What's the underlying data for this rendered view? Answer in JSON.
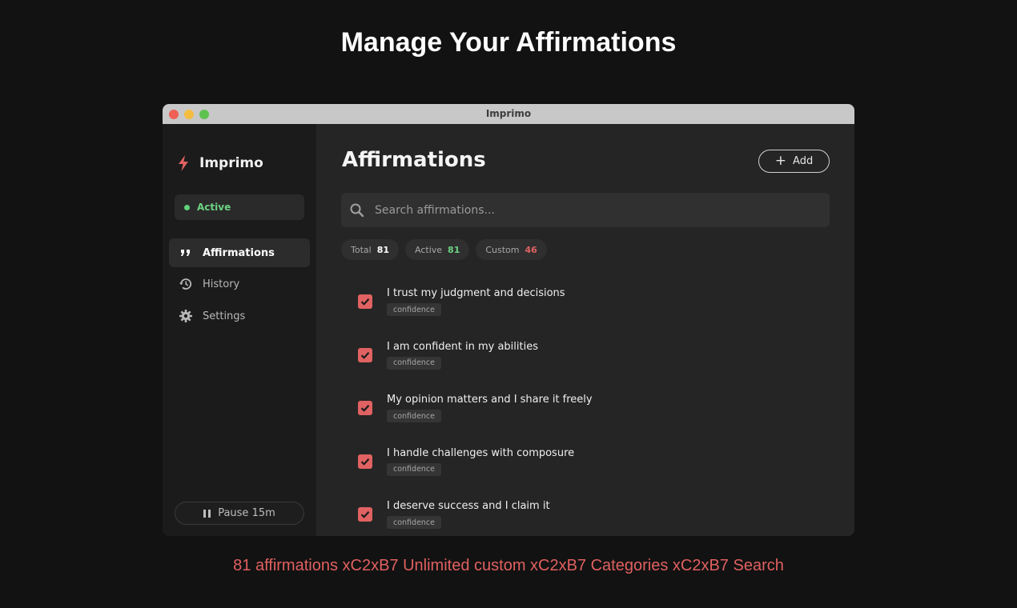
{
  "hero": {
    "title": "Manage Your Affirmations",
    "tagline": "81 affirmations xC2xB7 Unlimited custom xC2xB7 Categories xC2xB7 Search"
  },
  "window": {
    "title": "Imprimo"
  },
  "sidebar": {
    "app_name": "Imprimo",
    "status": "Active",
    "nav": [
      {
        "label": "Affirmations",
        "icon": "quote-icon",
        "active": true
      },
      {
        "label": "History",
        "icon": "history-icon",
        "active": false
      },
      {
        "label": "Settings",
        "icon": "gear-icon",
        "active": false
      }
    ],
    "pause_label": "Pause 15m"
  },
  "main": {
    "title": "Affirmations",
    "add_label": "Add",
    "search_placeholder": "Search affirmations...",
    "stats": [
      {
        "label": "Total",
        "value": "81",
        "color": "#ffffff"
      },
      {
        "label": "Active",
        "value": "81",
        "color": "#6cd382"
      },
      {
        "label": "Custom",
        "value": "46",
        "color": "#e06262"
      }
    ],
    "affirmations": [
      {
        "text": "I trust my judgment and decisions",
        "category": "confidence",
        "checked": true
      },
      {
        "text": "I am confident in my abilities",
        "category": "confidence",
        "checked": true
      },
      {
        "text": "My opinion matters and I share it freely",
        "category": "confidence",
        "checked": true
      },
      {
        "text": "I handle challenges with composure",
        "category": "confidence",
        "checked": true
      },
      {
        "text": "I deserve success and I claim it",
        "category": "confidence",
        "checked": true
      }
    ]
  },
  "colors": {
    "accent": "#e06262",
    "active_green": "#6cd382",
    "background": "#121212"
  }
}
